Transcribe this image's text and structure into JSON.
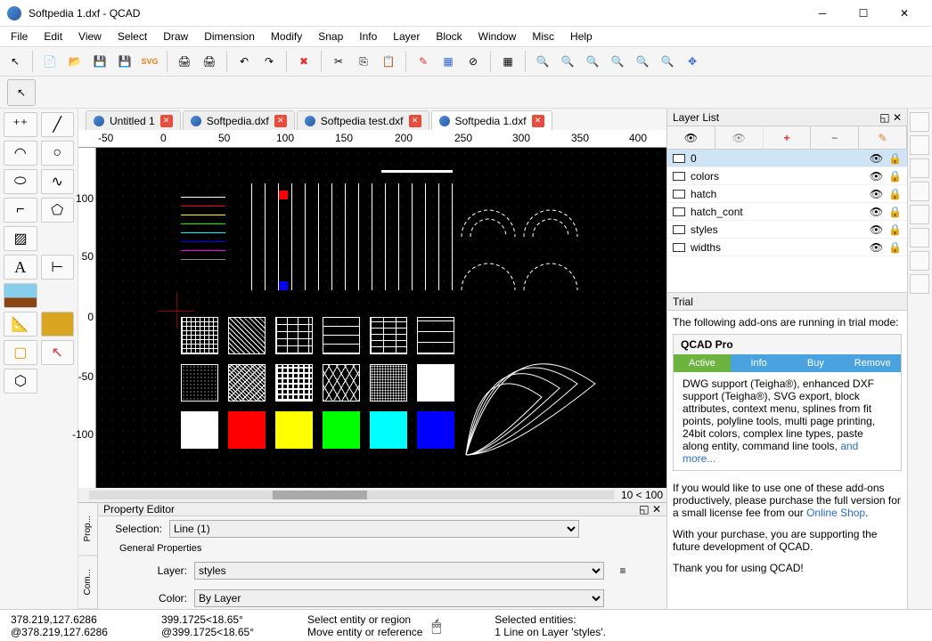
{
  "window": {
    "title": "Softpedia 1.dxf - QCAD"
  },
  "menu": [
    "File",
    "Edit",
    "View",
    "Select",
    "Draw",
    "Dimension",
    "Modify",
    "Snap",
    "Info",
    "Layer",
    "Block",
    "Window",
    "Misc",
    "Help"
  ],
  "tabs": [
    {
      "label": "Untitled 1",
      "active": false
    },
    {
      "label": "Softpedia.dxf",
      "active": false
    },
    {
      "label": "Softpedia test.dxf",
      "active": false
    },
    {
      "label": "Softpedia 1.dxf",
      "active": true
    }
  ],
  "ruler_h": [
    "-50",
    "0",
    "50",
    "100",
    "150",
    "200",
    "250",
    "300",
    "350",
    "400"
  ],
  "ruler_v": [
    "100",
    "50",
    "0",
    "-50",
    "-100"
  ],
  "hscroll": {
    "left": "",
    "right": "10 < 100"
  },
  "layers_title": "Layer List",
  "layers": [
    {
      "name": "0",
      "selected": true
    },
    {
      "name": "colors",
      "selected": false
    },
    {
      "name": "hatch",
      "selected": false
    },
    {
      "name": "hatch_cont",
      "selected": false
    },
    {
      "name": "styles",
      "selected": false
    },
    {
      "name": "widths",
      "selected": false
    }
  ],
  "trial": {
    "title": "Trial",
    "intro": "The following add-ons are running in trial mode:",
    "product": "QCAD Pro",
    "buttons": [
      {
        "label": "Active",
        "color": "#6db33f"
      },
      {
        "label": "Info",
        "color": "#4aa3df"
      },
      {
        "label": "Buy",
        "color": "#4aa3df"
      },
      {
        "label": "Remove",
        "color": "#4aa3df"
      }
    ],
    "features": "DWG support (Teigha®), enhanced DXF support (Teigha®), SVG export, block attributes, context menu, splines from fit points, polyline tools, multi page printing, 24bit colors, complex line types, paste along entity, command line tools, ",
    "more": "and more...",
    "purchase1": "If you would like to use one of these add-ons productively, please purchase the full version for a small license fee from our ",
    "shop": "Online Shop",
    "purchase2": "With your purchase, you are supporting the future development of QCAD.",
    "thanks": "Thank you for using QCAD!"
  },
  "prop": {
    "title": "Property Editor",
    "sel_label": "Selection:",
    "sel_value": "Line (1)",
    "group": "General Properties",
    "layer_label": "Layer:",
    "layer_value": "styles",
    "color_label": "Color:",
    "color_value": "By Layer",
    "tabs": [
      "Prop...",
      "Com..."
    ]
  },
  "status": {
    "abs": "378.219,127.6286",
    "rel": "@378.219,127.6286",
    "polar_abs": "399.1725<18.65°",
    "polar_rel": "@399.1725<18.65°",
    "hint1": "Select entity or region",
    "hint2": "Move entity or reference",
    "sel_title": "Selected entities:",
    "sel_info": "1 Line on Layer 'styles'."
  },
  "swatches": [
    "#ffffff",
    "#ff0000",
    "#ffff00",
    "#00ff00",
    "#00ffff",
    "#0000ff"
  ]
}
